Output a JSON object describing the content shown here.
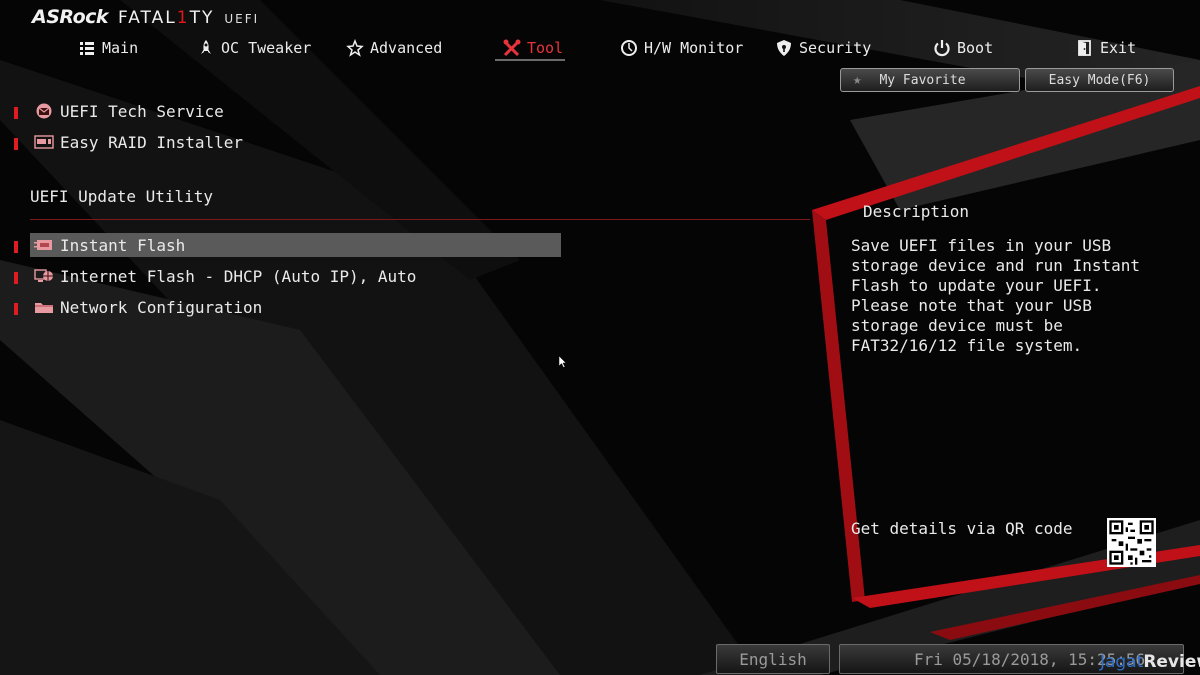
{
  "brand": {
    "asrock": "ASRock",
    "fatal_pre": "FATAL",
    "fatal_one": "1",
    "fatal_post": "TY",
    "uefi": "UEFI"
  },
  "nav": [
    {
      "label": "Main",
      "icon": "list-icon"
    },
    {
      "label": "OC Tweaker",
      "icon": "rocket-icon"
    },
    {
      "label": "Advanced",
      "icon": "star-icon"
    },
    {
      "label": "Tool",
      "icon": "tools-icon",
      "active": true
    },
    {
      "label": "H/W Monitor",
      "icon": "monitor-icon"
    },
    {
      "label": "Security",
      "icon": "shield-icon"
    },
    {
      "label": "Boot",
      "icon": "power-icon"
    },
    {
      "label": "Exit",
      "icon": "exit-door-icon"
    }
  ],
  "header_buttons": {
    "favorite": "My Favorite",
    "easy_mode": "Easy Mode(F6)"
  },
  "menu": {
    "top_items": [
      {
        "label": "UEFI Tech Service",
        "icon": "mail-icon"
      },
      {
        "label": "Easy RAID Installer",
        "icon": "raid-icon"
      }
    ],
    "section_title": "UEFI Update Utility",
    "section_items": [
      {
        "label": "Instant Flash",
        "icon": "bios-chip-icon",
        "selected": true
      },
      {
        "label": "Internet Flash - DHCP (Auto IP), Auto",
        "icon": "globe-monitor-icon"
      },
      {
        "label": "Network Configuration",
        "icon": "folder-icon"
      }
    ]
  },
  "description": {
    "title": "Description",
    "body": "Save UEFI files in your USB storage device and run Instant Flash to update your UEFI. Please note that your USB storage device must be FAT32/16/12 file system.",
    "qr_label": "Get details via QR code"
  },
  "footer": {
    "language": "English",
    "datetime": "Fri 05/18/2018, 15:25:56"
  },
  "watermark": {
    "part1": "Jagat",
    "part2": "Review"
  },
  "colors": {
    "accent_red": "#e01b22",
    "selected_bg": "#5a5a5a",
    "background": "#050505"
  }
}
